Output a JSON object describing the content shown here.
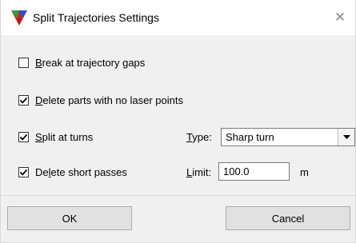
{
  "window": {
    "title": "Split Trajectories Settings",
    "close_symbol": "✕",
    "app_icon": "terrasolid-triangle-icon"
  },
  "options": {
    "break_gaps": {
      "label_pre": "",
      "label_u": "B",
      "label_post": "reak at trajectory gaps",
      "checked": false
    },
    "delete_no_laser": {
      "label_pre": "",
      "label_u": "D",
      "label_post": "elete parts with no laser points",
      "checked": true
    },
    "split_turns": {
      "label_pre": "",
      "label_u": "S",
      "label_post": "plit at turns",
      "checked": true
    },
    "delete_short": {
      "label_pre": "De",
      "label_u": "l",
      "label_post": "ete short passes",
      "checked": true
    }
  },
  "type_field": {
    "label_u": "T",
    "label_post": "ype:",
    "selected": "Sharp turn"
  },
  "limit_field": {
    "label_u": "L",
    "label_post": "imit:",
    "value": "100.0",
    "unit": "m"
  },
  "buttons": {
    "ok": "OK",
    "cancel": "Cancel"
  },
  "colors": {
    "dialog_background": "#f0f0f0",
    "titlebar_background": "#ffffff",
    "button_face": "#e1e1e1",
    "icon_red": "#d92020",
    "icon_green": "#2e9e3a",
    "icon_blue": "#2a4fd6"
  }
}
